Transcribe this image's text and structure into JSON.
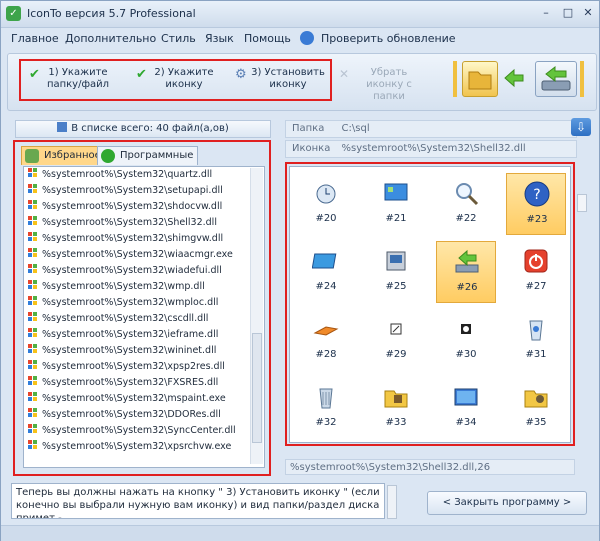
{
  "window": {
    "title": "IconTo версия 5.7 Professional",
    "controls": [
      "–",
      "□",
      "✕"
    ]
  },
  "menu": [
    "Главное",
    "Дополнительно",
    "Стиль",
    "Язык",
    "Помощь",
    "Проверить обновление"
  ],
  "toolbar": {
    "step1": "1) Укажите папку/файл",
    "step2": "2) Укажите иконку",
    "step3": "3) Установить иконку",
    "remove": "Убрать иконку с папки"
  },
  "left": {
    "count": "В списке всего: 40 файл(а,ов)",
    "tab_favorites": "Избранное",
    "tab_programs": "Программные",
    "files": [
      "%systemroot%\\System32\\quartz.dll",
      "%systemroot%\\System32\\setupapi.dll",
      "%systemroot%\\System32\\shdocvw.dll",
      "%systemroot%\\System32\\Shell32.dll",
      "%systemroot%\\System32\\shimgvw.dll",
      "%systemroot%\\System32\\wiaacmgr.exe",
      "%systemroot%\\System32\\wiadefui.dll",
      "%systemroot%\\System32\\wmp.dll",
      "%systemroot%\\System32\\wmploc.dll",
      "%systemroot%\\System32\\cscdll.dll",
      "%systemroot%\\System32\\ieframe.dll",
      "%systemroot%\\System32\\wininet.dll",
      "%systemroot%\\System32\\xpsp2res.dll",
      "%systemroot%\\System32\\FXSRES.dll",
      "%systemroot%\\System32\\mspaint.exe",
      "%systemroot%\\System32\\DDORes.dll",
      "%systemroot%\\System32\\SyncCenter.dll",
      "%systemroot%\\System32\\xpsrchvw.exe"
    ]
  },
  "right": {
    "folder_label": "Папка",
    "folder_value": "C:\\sql",
    "icon_label": "Иконка",
    "icon_value": "%systemroot%\\System32\\Shell32.dll",
    "status": "%systemroot%\\System32\\Shell32.dll,26",
    "icons": [
      "#20",
      "#21",
      "#22",
      "#23",
      "#24",
      "#25",
      "#26",
      "#27",
      "#28",
      "#29",
      "#30",
      "#31",
      "#32",
      "#33",
      "#34",
      "#35"
    ],
    "selected_icons": [
      "#23",
      "#26"
    ]
  },
  "message": "Теперь вы должны нажать на кнопку \" 3) Установить иконку \" (если конечно вы выбрали нужную вам иконку) и вид папки/раздел диска примет -",
  "close_button": "< Закрыть программу >",
  "colors": {
    "highlight": "#e02020",
    "selection": "#ffcc62",
    "panel": "#dbe6f3"
  }
}
